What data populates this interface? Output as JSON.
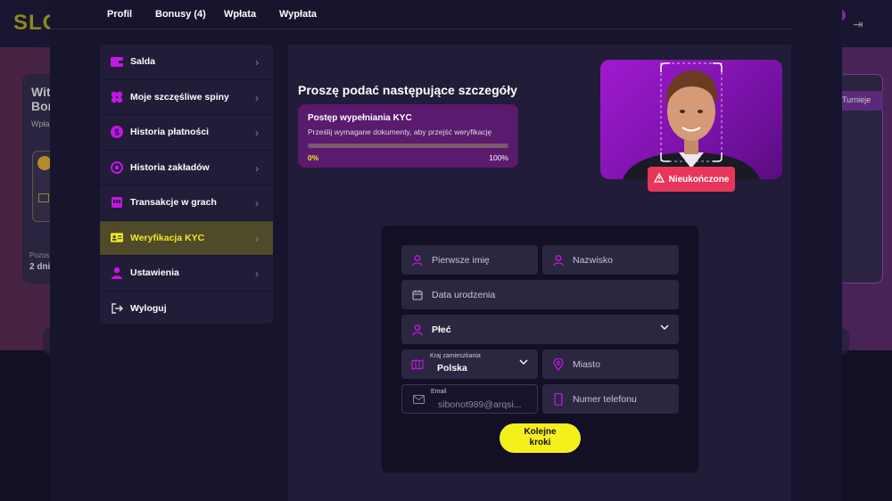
{
  "background": {
    "logo": "SLO",
    "card_title": "Wit\nBon",
    "card_sub": "Wpła",
    "card_foot1": "Pozos",
    "card_foot2": "2 dni",
    "turnieje": "Turnieje"
  },
  "tabs": [
    "Profil",
    "Bonusy (4)",
    "Wpłata",
    "Wypłata"
  ],
  "sidebar": {
    "items": [
      {
        "label": "Salda",
        "icon": "wallet-icon"
      },
      {
        "label": "Moje szczęśliwe spiny",
        "icon": "clover-icon"
      },
      {
        "label": "Historia płatności",
        "icon": "dollar-coin-icon"
      },
      {
        "label": "Historia zakładów",
        "icon": "football-icon"
      },
      {
        "label": "Transakcje w grach",
        "icon": "slot-machine-icon"
      },
      {
        "label": "Weryfikacja KYC",
        "icon": "id-card-icon",
        "active": true
      },
      {
        "label": "Ustawienia",
        "icon": "user-icon"
      },
      {
        "label": "Wyloguj",
        "icon": "logout-icon"
      }
    ]
  },
  "form": {
    "title": "Proszę podać następujące szczegóły",
    "kyc": {
      "heading": "Postęp wypełniania KYC",
      "subtitle": "Prześlij wymagane dokumenty, aby przejść weryfikację",
      "progress": 0,
      "progress_start": "0%",
      "progress_end": "100%"
    },
    "status_badge": "Nieukończone",
    "fields": {
      "first_name": "Pierwsze imię",
      "last_name": "Nazwisko",
      "birth_date": "Data urodzenia",
      "gender": "Płeć",
      "country_label": "Kraj zamieszkania",
      "country_value": "Polska",
      "city": "Miasto",
      "email_label": "Email",
      "email_value": "sibonot989@arqsi...",
      "phone": "Numer telefonu"
    },
    "next_button": "Kolejne\nkroki"
  },
  "colors": {
    "accent": "#f2ea1c",
    "purple": "#c416e6",
    "badge": "#e8365a"
  }
}
